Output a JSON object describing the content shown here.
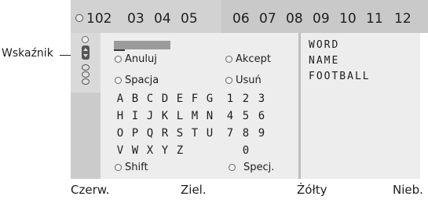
{
  "callout": {
    "label": "Wskaźnik"
  },
  "channels": [
    "102",
    "03",
    "04",
    "05",
    "06",
    "07",
    "08",
    "09",
    "10",
    "11",
    "12"
  ],
  "options": {
    "cancel": "Anuluj",
    "accept": "Akcept",
    "space": "Spacja",
    "delete": "Usuń",
    "shift": "Shift",
    "special": "Specj."
  },
  "keyboard": {
    "rows": [
      [
        "A",
        "B",
        "C",
        "D",
        "E",
        "F",
        "G",
        "1",
        "2",
        "3"
      ],
      [
        "H",
        "I",
        "J",
        "K",
        "L",
        "M",
        "N",
        "4",
        "5",
        "6"
      ],
      [
        "O",
        "P",
        "Q",
        "R",
        "S",
        "T",
        "U",
        "7",
        "8",
        "9"
      ],
      [
        "V",
        "W",
        "X",
        "Y",
        "Z",
        "",
        "",
        "",
        "0",
        ""
      ]
    ]
  },
  "words": [
    "WORD",
    "NAME",
    "FOOTBALL"
  ],
  "footer": {
    "red": "Czerw.",
    "green": "Ziel.",
    "yellow": "Żółty",
    "blue": "Nieb."
  },
  "colors": {
    "frame": "#d2d2d2",
    "panel": "#ededed",
    "highlight": "#c9c9c9"
  }
}
